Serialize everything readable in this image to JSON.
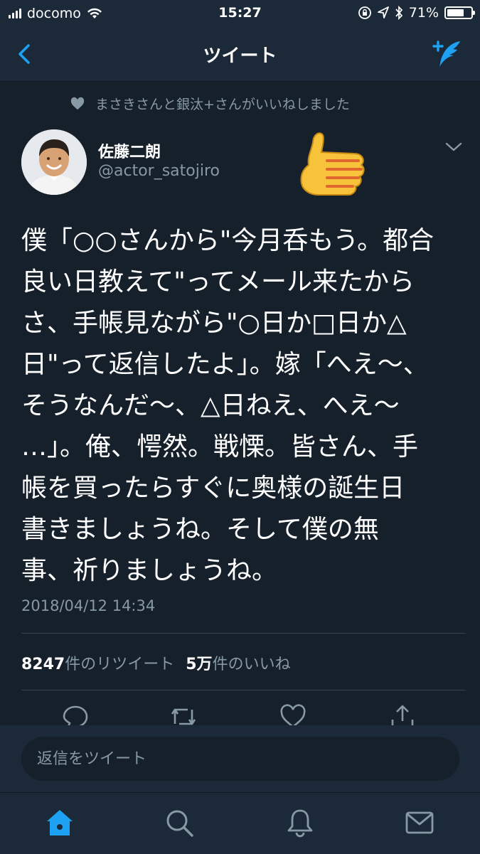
{
  "status_bar": {
    "carrier": "docomo",
    "time": "15:27",
    "battery": "71%",
    "battery_level": 0.71
  },
  "nav": {
    "title": "ツイート",
    "back_icon": "chevron-left-icon",
    "compose_icon": "compose-tweet-icon"
  },
  "context": {
    "icon": "heart-icon",
    "text": "まさきさんと銀汰+さんがいいねしました"
  },
  "tweet": {
    "author_name": "佐藤二朗",
    "author_handle": "@actor_satojiro",
    "lines": [
      "僕「○○さんから\"今月呑もう。都合",
      "良い日教えて\"ってメール来たから",
      "さ、手帳見ながら\"○日か□日か△",
      "日\"って返信したよ」。嫁「へえ〜、",
      "そうなんだ〜、△日ねえ、へえ〜",
      "…」。俺、愕然。戦慄。皆さん、手",
      "帳を買ったらすぐに奥様の誕生日",
      "書きましょうね。そして僕の無",
      "事、祈りましょうね。"
    ],
    "timestamp": "2018/04/12 14:34"
  },
  "stats": {
    "retweets_count": "8247",
    "retweets_label": "件のリツイート",
    "likes_count": "5万",
    "likes_label": "件のいいね"
  },
  "actions": [
    "reply-icon",
    "retweet-icon",
    "like-icon",
    "share-icon"
  ],
  "reply_bar": {
    "placeholder": "返信をツイート"
  },
  "tab_bar": [
    "home-icon",
    "search-icon",
    "notifications-icon",
    "messages-icon"
  ],
  "colors": {
    "background": "#15202b",
    "bar": "#1c2938",
    "accent": "#1da1f2",
    "secondary_text": "#8899a6",
    "divider": "#38444d"
  }
}
